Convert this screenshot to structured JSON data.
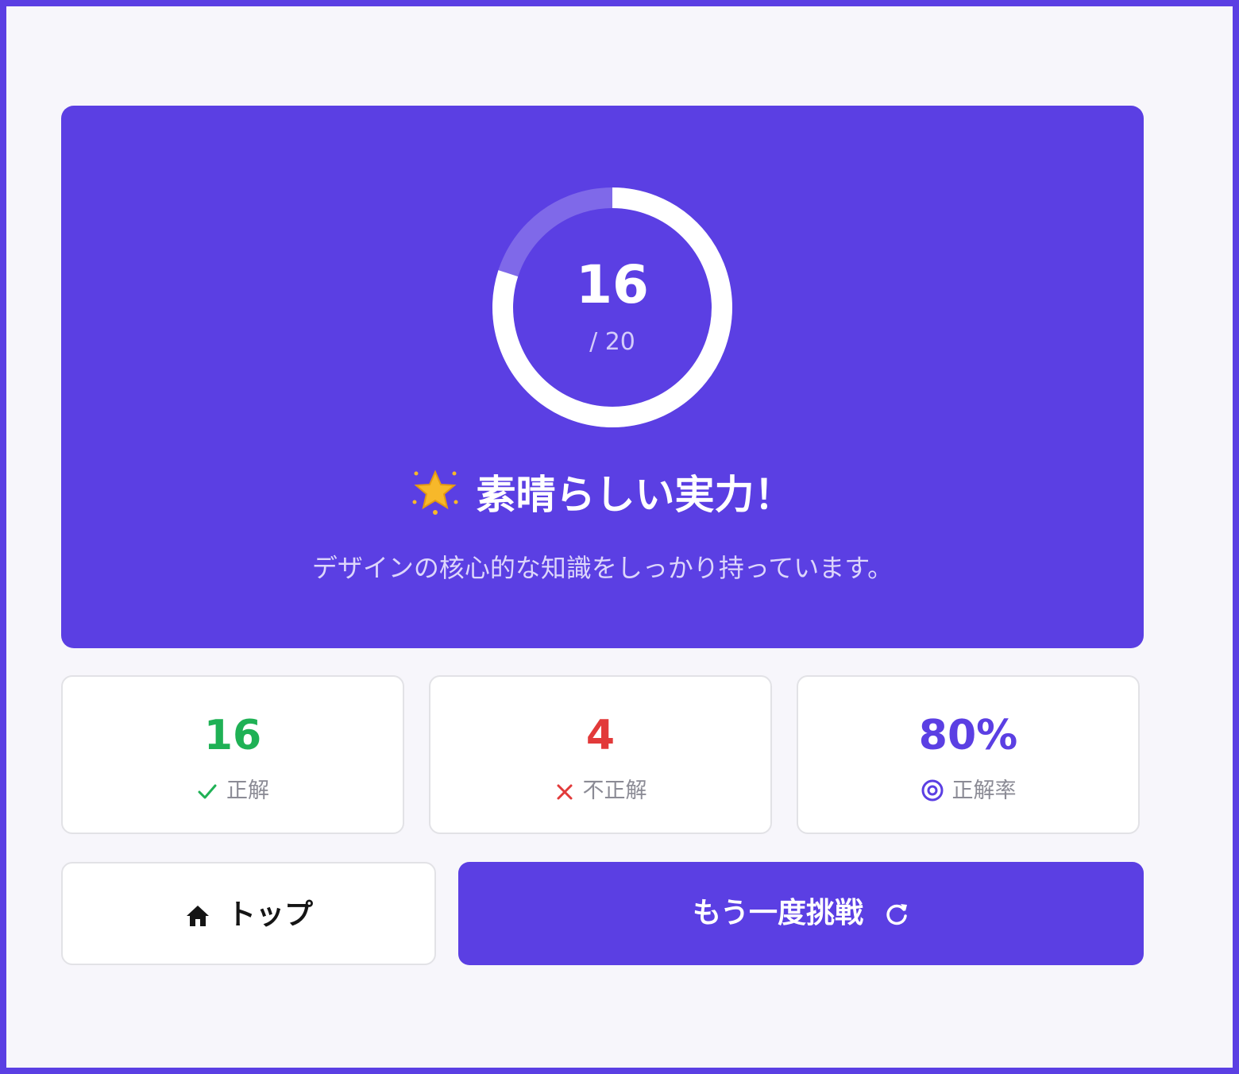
{
  "result": {
    "score": "16",
    "total": "/ 20",
    "progress_fraction": 0.8,
    "title": "素晴らしい実力！",
    "title_icon": "glowing-star-icon",
    "message": "デザインの核心的な知識をしっかり持っています。"
  },
  "stats": [
    {
      "value": "16",
      "label": "正解",
      "icon": "check-icon",
      "color": "#1fb155"
    },
    {
      "value": "4",
      "label": "不正解",
      "icon": "cross-icon",
      "color": "#e23a3a"
    },
    {
      "value": "80%",
      "label": "正解率",
      "icon": "target-icon",
      "color": "#5b3fe3"
    }
  ],
  "actions": {
    "top_label": "トップ",
    "top_icon": "home-icon",
    "retry_label": "もう一度挑戦",
    "retry_icon": "refresh-icon"
  },
  "colors": {
    "accent": "#5b3fe3",
    "background": "#f7f6fb",
    "correct": "#1fb155",
    "incorrect": "#e23a3a"
  }
}
